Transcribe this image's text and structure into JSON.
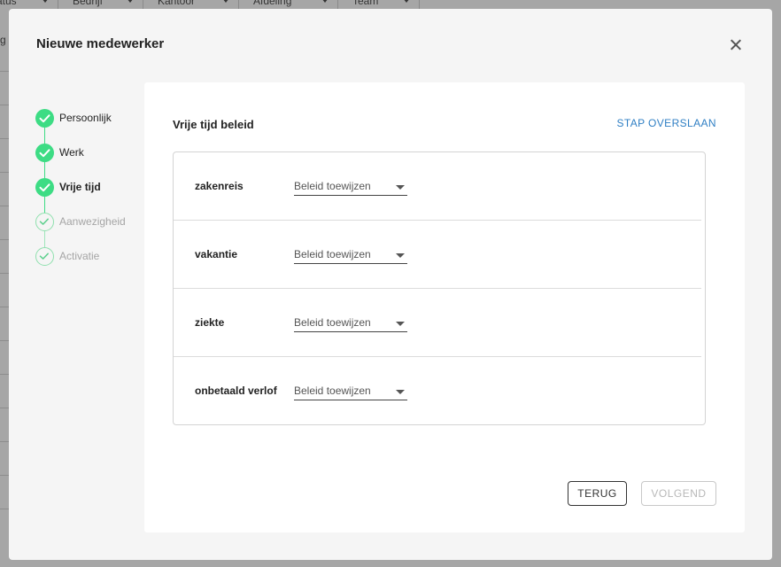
{
  "background": {
    "columns": [
      {
        "label": "atus"
      },
      {
        "label": "Bedrijf"
      },
      {
        "label": "Kantoor"
      },
      {
        "label": "Afdeling"
      },
      {
        "label": "Team"
      }
    ],
    "row_fragment": "g"
  },
  "modal": {
    "title": "Nieuwe medewerker",
    "close_icon": "close-icon"
  },
  "stepper": {
    "steps": [
      {
        "label": "Persoonlijk",
        "state": "done"
      },
      {
        "label": "Werk",
        "state": "done"
      },
      {
        "label": "Vrije tijd",
        "state": "current"
      },
      {
        "label": "Aanwezigheid",
        "state": "todo"
      },
      {
        "label": "Activatie",
        "state": "todo"
      }
    ],
    "colors": {
      "done": "#3ddc84",
      "todo_border": "#8fe0ae"
    }
  },
  "panel": {
    "title": "Vrije tijd beleid",
    "skip_label": "STAP OVERSLAAN",
    "policies": [
      {
        "label": "zakenreis",
        "value": "Beleid toewijzen"
      },
      {
        "label": "vakantie",
        "value": "Beleid toewijzen"
      },
      {
        "label": "ziekte",
        "value": "Beleid toewijzen"
      },
      {
        "label": "onbetaald verlof",
        "value": "Beleid toewijzen"
      }
    ],
    "back_label": "TERUG",
    "next_label": "VOLGEND"
  },
  "colors": {
    "link": "#2f7fc4",
    "accent": "#3ddc84"
  }
}
